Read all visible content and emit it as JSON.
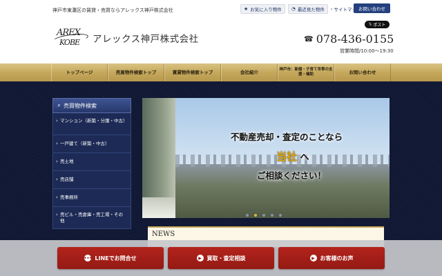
{
  "header": {
    "tagline": "神戸市東灘区の賃貸・売買ならアレックス神戸株式会社",
    "favorites_label": "お気に入り物件",
    "recent_label": "最近見た物件",
    "sitemap_label": "サイトマップ",
    "contact_label": "お問い合わせ",
    "x_post_label": "ポスト",
    "logo_line1": "AREX",
    "logo_line2": "KOBE",
    "company_name": "アレックス神戸株式会社",
    "phone": "078-436-0155",
    "hours": "営業時間/10:00～19:30"
  },
  "nav": {
    "items": [
      {
        "label": "トップページ"
      },
      {
        "label": "売買物件検索トップ"
      },
      {
        "label": "賃貸物件検索トップ"
      },
      {
        "label": "会社紹介"
      },
      {
        "label": "神戸市：新婚・子育て世帯の支援・補助"
      },
      {
        "label": "お問い合わせ"
      }
    ]
  },
  "sidebar": {
    "title": "売買物件検索",
    "items": [
      {
        "label": "マンション（新築・分譲・中古）"
      },
      {
        "label": "一戸建て（新築・中古）"
      },
      {
        "label": "売土地"
      },
      {
        "label": "売店舗"
      },
      {
        "label": "売事務所"
      },
      {
        "label": "売ビル・売倉庫・売工場・その他"
      }
    ]
  },
  "hero": {
    "line1": "不動産売却・査定のことなら",
    "highlight": "当社",
    "line2_suffix": " へ",
    "line3": "ご相談ください！",
    "slide_count": 5,
    "active_slide": 2
  },
  "news": {
    "title": "NEWS"
  },
  "cta": {
    "line_label": "LINEでお問合せ",
    "purchase_label": "買取・査定相談",
    "voice_label": "お客様のお声"
  },
  "colors": {
    "navy": "#24407e",
    "gold": "#c5a85c",
    "cta_red": "#a11f18",
    "main_bg": "#0f1733"
  }
}
